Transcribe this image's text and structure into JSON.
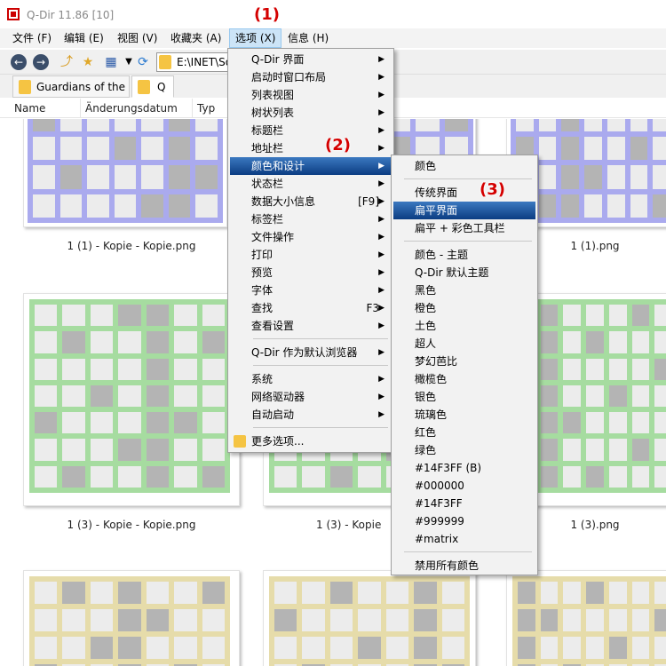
{
  "window": {
    "title": "Q-Dir 11.86 [10]"
  },
  "menubar": [
    "文件 (F)",
    "编辑 (E)",
    "视图 (V)",
    "收藏夹 (A)",
    "选项 (X)",
    "信息 (H)"
  ],
  "toolbar": {
    "address": "E:\\INET\\So"
  },
  "tabs": [
    "Guardians of the",
    "Q"
  ],
  "columns": [
    "Name",
    "Änderungsdatum",
    "Typ"
  ],
  "files": {
    "row1": [
      "1 (1) - Kopie - Kopie.png",
      "1 (1).png"
    ],
    "row2": [
      "1 (3) - Kopie - Kopie.png",
      "1 (3) - Kopie",
      "1 (3).png"
    ]
  },
  "options_menu": {
    "items": [
      {
        "label": "Q-Dir 界面",
        "arrow": true
      },
      {
        "label": "启动时窗口布局",
        "arrow": true
      },
      {
        "label": "列表视图",
        "arrow": true
      },
      {
        "label": "树状列表",
        "arrow": true
      },
      {
        "label": "标题栏",
        "arrow": true
      },
      {
        "label": "地址栏",
        "arrow": true
      },
      {
        "label": "颜色和设计",
        "arrow": true
      },
      {
        "label": "状态栏",
        "arrow": true
      },
      {
        "label": "数据大小信息",
        "key": "[F9]",
        "arrow": true
      },
      {
        "label": "标签栏",
        "arrow": true
      },
      {
        "label": "文件操作",
        "arrow": true
      },
      {
        "label": "打印",
        "arrow": true
      },
      {
        "label": "预览",
        "arrow": true
      },
      {
        "label": "字体",
        "arrow": true
      },
      {
        "label": "查找",
        "key": "F3",
        "arrow": true
      },
      {
        "label": "查看设置",
        "arrow": true
      },
      {
        "label": "Q-Dir 作为默认浏览器",
        "arrow": true
      },
      {
        "label": "系统",
        "arrow": true
      },
      {
        "label": "网络驱动器",
        "arrow": true
      },
      {
        "label": "自动启动",
        "arrow": true
      },
      {
        "label": "更多选项..."
      }
    ]
  },
  "color_submenu": {
    "items": [
      "颜色",
      "传统界面",
      "扁平界面",
      "扁平 + 彩色工具栏",
      "颜色 - 主题",
      "Q-Dir 默认主题",
      "黑色",
      "橙色",
      "土色",
      "超人",
      "梦幻芭比",
      "橄榄色",
      "银色",
      "琉璃色",
      "红色",
      "绿色",
      "#14F3FF (B)",
      "#000000",
      "#14F3FF",
      "#999999",
      "#matrix",
      "禁用所有颜色"
    ]
  },
  "callouts": [
    "(1)",
    "(2)",
    "(3)"
  ],
  "colors": {
    "purple": "#aaaaee",
    "green": "#a6dca0",
    "tan": "#e6dcaa",
    "highlight": "#0b3c82"
  }
}
